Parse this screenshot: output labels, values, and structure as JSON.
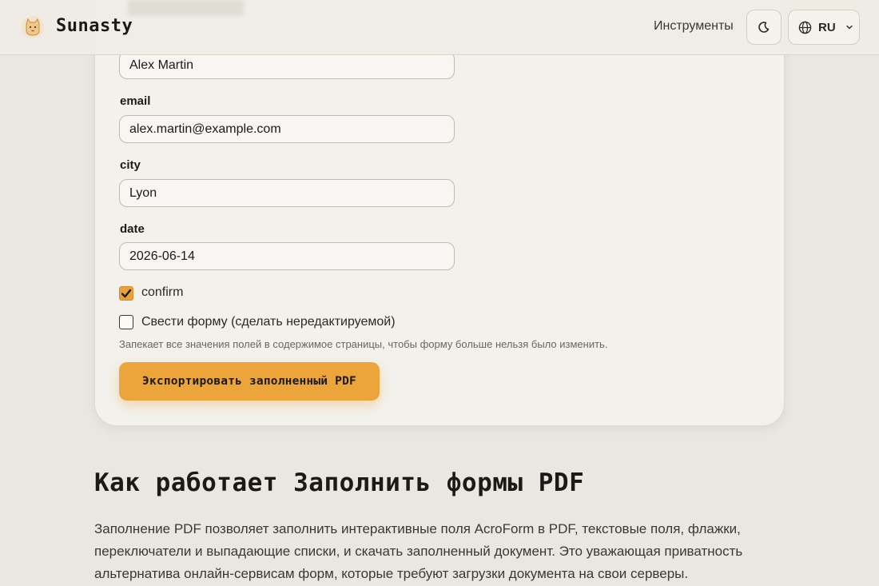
{
  "header": {
    "brand": "Sunasty",
    "nav_tools": "Инструменты",
    "language": "RU"
  },
  "form": {
    "name_value": "Alex Martin",
    "email_label": "email",
    "email_value": "alex.martin@example.com",
    "city_label": "city",
    "city_value": "Lyon",
    "date_label": "date",
    "date_value": "2026-06-14",
    "confirm_label": "confirm",
    "confirm_checked": true,
    "flatten_label": "Свести форму (сделать нередактируемой)",
    "flatten_checked": false,
    "flatten_hint": "Запекает все значения полей в содержимое страницы, чтобы форму больше нельзя было изменить.",
    "export_label": "Экспортировать заполненный PDF"
  },
  "article": {
    "title": "Как работает Заполнить формы PDF",
    "body": "Заполнение PDF позволяет заполнить интерактивные поля AcroForm в PDF, текстовые поля, флажки, переключатели и выпадающие списки, и скачать заполненный документ. Это уважающая приватность альтернатива онлайн-сервисам форм, которые требуют загрузки документа на свои серверы."
  },
  "colors": {
    "accent": "#eca53b",
    "background": "#e9e7e1",
    "card": "#f3f1ec"
  }
}
